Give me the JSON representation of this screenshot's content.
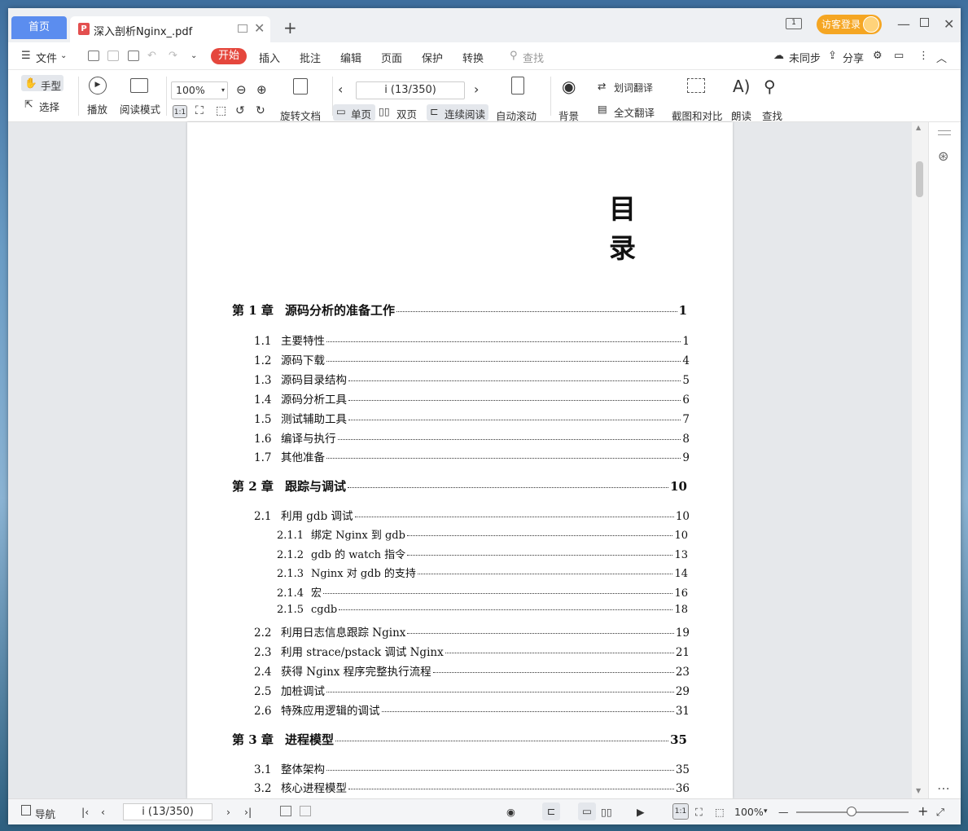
{
  "titlebar": {
    "home_tab": "首页",
    "doc_tab": "深入剖析Nginx_.pdf",
    "login": "访客登录",
    "page_indicator": "1"
  },
  "menubar": {
    "file": "文件",
    "items": [
      "开始",
      "插入",
      "批注",
      "编辑",
      "页面",
      "保护",
      "转换"
    ],
    "search": "查找",
    "sync": "未同步",
    "share": "分享"
  },
  "ribbon": {
    "hand": "手型",
    "select": "选择",
    "play": "播放",
    "read_mode": "阅读模式",
    "zoom": "100%",
    "rotate": "旋转文档",
    "page_value": "i (13/350)",
    "single": "单页",
    "double": "双页",
    "continuous": "连续阅读",
    "autoscroll": "自动滚动",
    "background": "背景",
    "word_translate": "划词翻译",
    "full_translate": "全文翻译",
    "screenshot_compare": "截图和对比",
    "read_aloud": "朗读",
    "find": "查找"
  },
  "document": {
    "toc_title": "目　录",
    "entries": [
      {
        "level": "ch",
        "num": "第 1 章",
        "text": "源码分析的准备工作",
        "page": "1"
      },
      {
        "level": "sec",
        "num": "1.1",
        "text": "主要特性",
        "page": "1"
      },
      {
        "level": "sec",
        "num": "1.2",
        "text": "源码下载",
        "page": "4"
      },
      {
        "level": "sec",
        "num": "1.3",
        "text": "源码目录结构",
        "page": "5"
      },
      {
        "level": "sec",
        "num": "1.4",
        "text": "源码分析工具",
        "page": "6"
      },
      {
        "level": "sec",
        "num": "1.5",
        "text": "测试辅助工具",
        "page": "7"
      },
      {
        "level": "sec",
        "num": "1.6",
        "text": "编译与执行",
        "page": "8"
      },
      {
        "level": "sec",
        "num": "1.7",
        "text": "其他准备",
        "page": "9"
      },
      {
        "level": "ch",
        "num": "第 2 章",
        "text": "跟踪与调试",
        "page": "10"
      },
      {
        "level": "sec",
        "num": "2.1",
        "text": "利用 gdb 调试",
        "page": "10"
      },
      {
        "level": "sub",
        "num": "2.1.1",
        "text": "绑定 Nginx 到 gdb",
        "page": "10"
      },
      {
        "level": "sub",
        "num": "2.1.2",
        "text": "gdb 的 watch 指令",
        "page": "13"
      },
      {
        "level": "sub",
        "num": "2.1.3",
        "text": "Nginx 对 gdb 的支持",
        "page": "14"
      },
      {
        "level": "sub",
        "num": "2.1.4",
        "text": "宏",
        "page": "16"
      },
      {
        "level": "sub",
        "num": "2.1.5",
        "text": "cgdb",
        "page": "18"
      },
      {
        "level": "sec",
        "num": "2.2",
        "text": "利用日志信息跟踪 Nginx",
        "page": "19"
      },
      {
        "level": "sec",
        "num": "2.3",
        "text": "利用 strace/pstack 调试 Nginx",
        "page": "21"
      },
      {
        "level": "sec",
        "num": "2.4",
        "text": "获得 Nginx 程序完整执行流程",
        "page": "23"
      },
      {
        "level": "sec",
        "num": "2.5",
        "text": "加桩调试",
        "page": "29"
      },
      {
        "level": "sec",
        "num": "2.6",
        "text": "特殊应用逻辑的调试",
        "page": "31"
      },
      {
        "level": "ch",
        "num": "第 3 章",
        "text": "进程模型",
        "page": "35"
      },
      {
        "level": "sec",
        "num": "3.1",
        "text": "整体架构",
        "page": "35"
      },
      {
        "level": "sec",
        "num": "3.2",
        "text": "核心进程模型",
        "page": "36"
      }
    ]
  },
  "statusbar": {
    "nav": "导航",
    "page_value": "i (13/350)",
    "zoom": "100%"
  }
}
